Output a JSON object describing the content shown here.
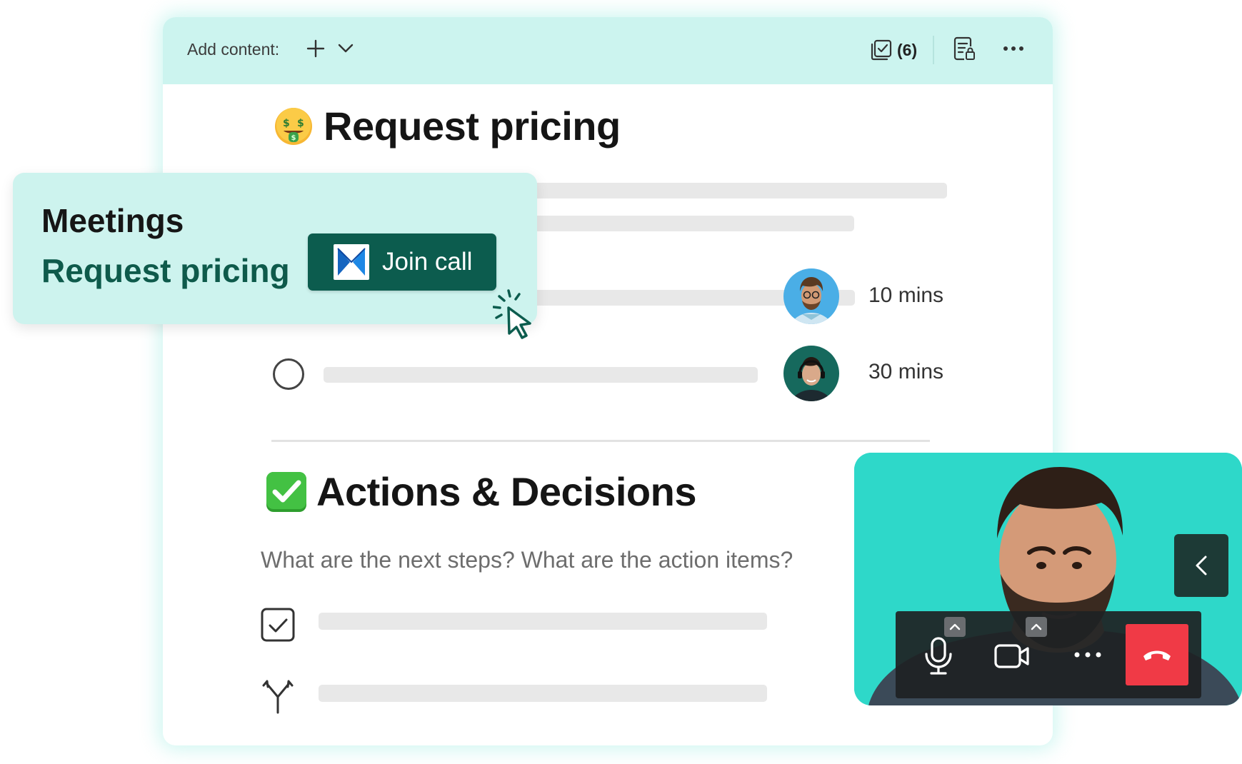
{
  "colors": {
    "toolbar_bg": "#ccf4ef",
    "meetings_bg": "#cdf3ee",
    "accent_green": "#0c5c4e",
    "call_bg": "#2ed8c9",
    "hangup_red": "#f03a46"
  },
  "toolbar": {
    "add_content_label": "Add content:",
    "task_count": "(6)"
  },
  "section_pricing": {
    "emoji": "money-mouth-face",
    "title": "Request pricing",
    "items": [
      {
        "duration": "10 mins"
      },
      {
        "duration": "30 mins"
      }
    ]
  },
  "section_actions": {
    "emoji": "check-mark-button",
    "title": "Actions & Decisions",
    "prompt": "What are the next steps? What are the action items?"
  },
  "meetings_popup": {
    "title": "Meetings",
    "meeting_name": "Request pricing",
    "join_label": "Join call"
  }
}
